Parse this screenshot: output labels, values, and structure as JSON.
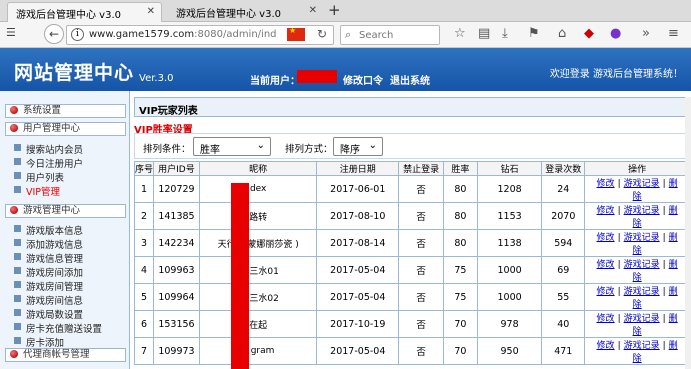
{
  "browser": {
    "tabs": [
      {
        "title": "游戏后台管理中心 v3.0",
        "active": true
      },
      {
        "title": "游戏后台管理中心 v3.0",
        "active": false
      }
    ],
    "url_host": "www.game1579.com",
    "url_path": ":8080/admin/ind",
    "search_placeholder": "Search"
  },
  "header": {
    "logo": "网站管理中心",
    "version": "Ver.3.0",
    "current_user_label": "当前用户：",
    "change_password": "修改口令",
    "logout": "退出系统",
    "welcome": "欢迎登录 游戏后台管理系统！"
  },
  "sidebar": {
    "sections": [
      {
        "label": "系统设置"
      },
      {
        "label": "用户管理中心"
      },
      {
        "label": "游戏管理中心"
      },
      {
        "label": "代理商帐号管理"
      }
    ],
    "user_items": [
      "搜索站内会员",
      "今日注册用户",
      "用户列表",
      "VIP管理"
    ],
    "game_items": [
      "游戏版本信息",
      "添加游戏信息",
      "游戏信息管理",
      "游戏房间添加",
      "游戏房间管理",
      "游戏房间信息",
      "游戏局数设置",
      "房卡充值赠送设置",
      "房卡添加"
    ]
  },
  "content": {
    "title": "VIP玩家列表",
    "subtitle": "VIP胜率设置",
    "sort_field_label": "排列条件：",
    "sort_field_value": "胜率",
    "sort_order_label": "排列方式：",
    "sort_order_value": "降序",
    "columns": [
      "序号",
      "用户ID号",
      "昵称",
      "注册日期",
      "禁止登录",
      "胜率",
      "钻石",
      "登录次数",
      "操作"
    ],
    "ops": {
      "edit": "修改",
      "record": "游戏记录",
      "delete_1": "删",
      "delete_2": "除"
    },
    "rows": [
      {
        "no": "1",
        "uid": "120729",
        "nick": "dex",
        "date": "2017-06-01",
        "ban": "否",
        "rate": "80",
        "diamond": "1208",
        "logins": "24"
      },
      {
        "no": "2",
        "uid": "141385",
        "nick": "路转",
        "date": "2017-08-10",
        "ban": "否",
        "rate": "80",
        "diamond": "1153",
        "logins": "2070"
      },
      {
        "no": "3",
        "uid": "142234",
        "nick": "天行健 蒙娜丽莎瓷 )",
        "date": "2017-08-14",
        "ban": "否",
        "rate": "80",
        "diamond": "1138",
        "logins": "594"
      },
      {
        "no": "4",
        "uid": "109963",
        "nick": "八 三水01",
        "date": "2017-05-04",
        "ban": "否",
        "rate": "75",
        "diamond": "1000",
        "logins": "69"
      },
      {
        "no": "5",
        "uid": "109964",
        "nick": "八 三水02",
        "date": "2017-05-04",
        "ban": "否",
        "rate": "75",
        "diamond": "1000",
        "logins": "55"
      },
      {
        "no": "6",
        "uid": "153156",
        "nick": "在起",
        "date": "2017-10-19",
        "ban": "否",
        "rate": "70",
        "diamond": "978",
        "logins": "40"
      },
      {
        "no": "7",
        "uid": "109973",
        "nick": "K gram",
        "date": "2017-05-04",
        "ban": "否",
        "rate": "70",
        "diamond": "950",
        "logins": "471"
      }
    ]
  }
}
